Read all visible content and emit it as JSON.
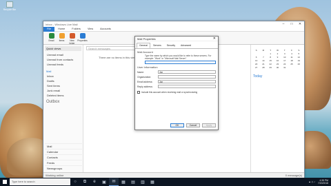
{
  "desktop": {
    "icon_label": "Recycle Bin"
  },
  "mail": {
    "title": "Inbox - Windows Live Mail",
    "controls": [
      "–",
      "□",
      "✕"
    ],
    "tabs": [
      "File",
      "Home",
      "Folders",
      "View",
      "Accounts"
    ],
    "ribbon": [
      {
        "label": "Email",
        "color": "#2b8a3e"
      },
      {
        "label": "Items",
        "color": "#f0a030"
      },
      {
        "label": "New folder",
        "color": "#d35a2b"
      },
      {
        "label": "Properties",
        "color": "#2b7cd3"
      }
    ],
    "nav": {
      "header": "Quick views",
      "quick": [
        "Unread email",
        "Unread from contacts",
        "Unread feeds"
      ],
      "account_label": "Mail",
      "folders": [
        "Inbox",
        "Drafts",
        "Sent items",
        "Junk email",
        "Deleted items"
      ],
      "outbox": "Outbox",
      "bottom": [
        "Mail",
        "Calendar",
        "Contacts",
        "Feeds",
        "Newsgroups"
      ]
    },
    "search_placeholder": "Search messages",
    "empty_message": "There are no items in this view.",
    "calendar": {
      "days": [
        "S",
        "M",
        "T",
        "W",
        "T",
        "F",
        "S"
      ],
      "dates": [
        "",
        "",
        "1",
        "2",
        "3",
        "4",
        "5",
        "6",
        "7",
        "8",
        "9",
        "10",
        "11",
        "12",
        "13",
        "14",
        "15",
        "16",
        "17",
        "18",
        "19",
        "20",
        "21",
        "22",
        "23",
        "24",
        "25",
        "26",
        "27",
        "28",
        "29",
        "30",
        "31"
      ],
      "today_label": "Today"
    },
    "status_left": "Working online",
    "status_right": "0 message(s)"
  },
  "dialog": {
    "title": "Mail Properties",
    "close": "✕",
    "tabs": [
      "General",
      "Servers",
      "Security",
      "Advanced"
    ],
    "mail_account_heading": "Mail Account",
    "mail_account_text": "Type the name by which you would like to refer to these servers. For example: \"Work\" or \"Microsoft Mail Server\".",
    "user_info_heading": "User Information",
    "fields": [
      {
        "label": "Name:",
        "value": "Jon"
      },
      {
        "label": "Organization:",
        "value": ""
      },
      {
        "label": "Email address:",
        "value": "Jon"
      },
      {
        "label": "Reply address:",
        "value": ""
      }
    ],
    "checkbox_label": "Include this account when receiving mail or synchronizing",
    "buttons": [
      "OK",
      "Cancel",
      "Apply"
    ]
  },
  "taskbar": {
    "search_placeholder": "Type here to search",
    "apps": [
      "○",
      "⧉",
      "e",
      "▣",
      "✉",
      "▦",
      "▤",
      "▥",
      "▦"
    ],
    "time": "4:35 PM",
    "date": "7/20/2018"
  }
}
